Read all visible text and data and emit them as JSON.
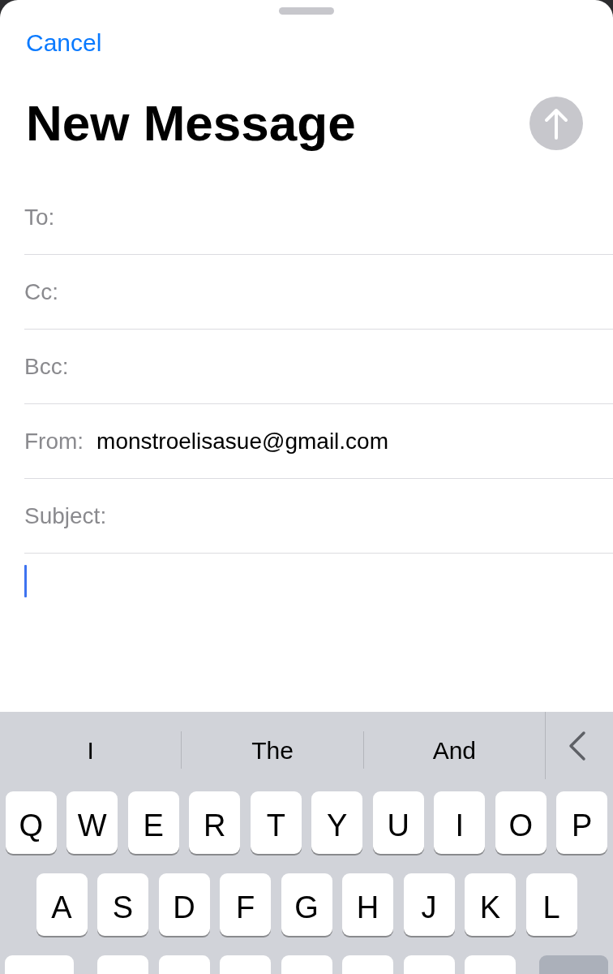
{
  "cancel_button": {
    "label": "Cancel"
  },
  "title": "New Message",
  "send_button": {
    "disabled": true
  },
  "fields": [
    {
      "label": "To:"
    },
    {
      "label": "Cc:"
    },
    {
      "label": "Bcc:"
    },
    {
      "label": "From:",
      "value": "monstroelisasue@gmail.com"
    },
    {
      "label": "Subject:"
    }
  ],
  "body": {
    "focused": true
  },
  "keyboard": {
    "suggestions": [
      "I",
      "The",
      "And"
    ],
    "rows": [
      [
        {
          "kind": "letter",
          "label": "Q"
        },
        {
          "kind": "letter",
          "label": "W"
        },
        {
          "kind": "letter",
          "label": "E"
        },
        {
          "kind": "letter",
          "label": "R"
        },
        {
          "kind": "letter",
          "label": "T"
        },
        {
          "kind": "letter",
          "label": "Y"
        },
        {
          "kind": "letter",
          "label": "U"
        },
        {
          "kind": "letter",
          "label": "I"
        },
        {
          "kind": "letter",
          "label": "O"
        },
        {
          "kind": "letter",
          "label": "P"
        }
      ],
      [
        {
          "kind": "letter",
          "label": "A"
        },
        {
          "kind": "letter",
          "label": "S"
        },
        {
          "kind": "letter",
          "label": "D"
        },
        {
          "kind": "letter",
          "label": "F"
        },
        {
          "kind": "letter",
          "label": "G"
        },
        {
          "kind": "letter",
          "label": "H"
        },
        {
          "kind": "letter",
          "label": "J"
        },
        {
          "kind": "letter",
          "label": "K"
        },
        {
          "kind": "letter",
          "label": "L"
        }
      ],
      [
        {
          "kind": "shift",
          "on": true
        },
        {
          "kind": "letter"
        },
        {
          "kind": "letter"
        },
        {
          "kind": "letter"
        },
        {
          "kind": "letter"
        },
        {
          "kind": "letter"
        },
        {
          "kind": "letter"
        },
        {
          "kind": "letter"
        },
        {
          "kind": "delete"
        }
      ]
    ]
  }
}
